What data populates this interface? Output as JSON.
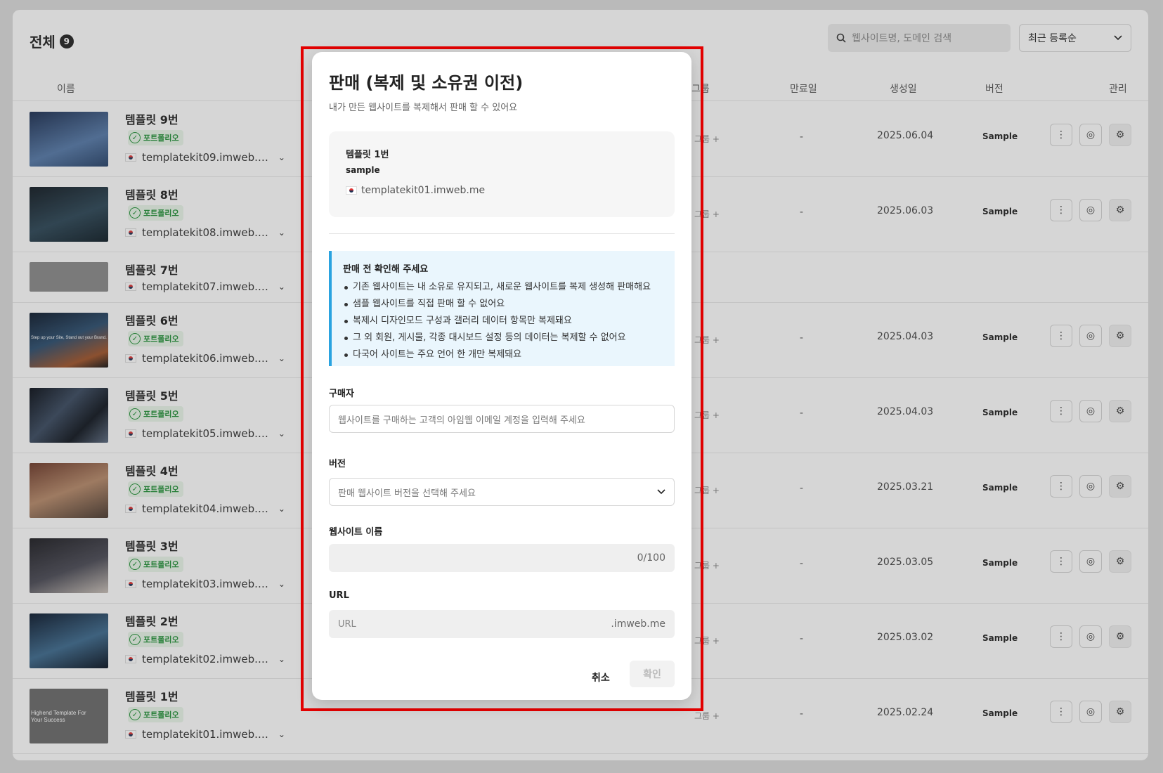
{
  "header": {
    "title": "전체",
    "count": "9"
  },
  "search": {
    "placeholder": "웹사이트명, 도메인 검색"
  },
  "sort": {
    "selected": "최근 등록순"
  },
  "columns": {
    "name": "이름",
    "group": "그룹",
    "expiry": "만료일",
    "created": "생성일",
    "version": "버전",
    "manage": "관리"
  },
  "rows": [
    {
      "name": "템플릿 9번",
      "badge": "포트폴리오",
      "domain": "templatekit09.imweb.…",
      "group": "그룹 +",
      "expiry": "-",
      "created": "2025.06.04",
      "version": "Sample"
    },
    {
      "name": "템플릿 8번",
      "badge": "포트폴리오",
      "domain": "templatekit08.imweb.…",
      "group": "그룹 +",
      "expiry": "-",
      "created": "2025.06.03",
      "version": "Sample"
    },
    {
      "name": "템플릿 7번",
      "badge": "",
      "domain": "templatekit07.imweb.…",
      "group": "",
      "expiry": "",
      "created": "",
      "version": ""
    },
    {
      "name": "템플릿 6번",
      "badge": "포트폴리오",
      "domain": "templatekit06.imweb.…",
      "group": "그룹 +",
      "expiry": "-",
      "created": "2025.04.03",
      "version": "Sample"
    },
    {
      "name": "템플릿 5번",
      "badge": "포트폴리오",
      "domain": "templatekit05.imweb.…",
      "group": "그룹 +",
      "expiry": "-",
      "created": "2025.04.03",
      "version": "Sample"
    },
    {
      "name": "템플릿 4번",
      "badge": "포트폴리오",
      "domain": "templatekit04.imweb.…",
      "group": "그룹 +",
      "expiry": "-",
      "created": "2025.03.21",
      "version": "Sample"
    },
    {
      "name": "템플릿 3번",
      "badge": "포트폴리오",
      "domain": "templatekit03.imweb.…",
      "group": "그룹 +",
      "expiry": "-",
      "created": "2025.03.05",
      "version": "Sample"
    },
    {
      "name": "템플릿 2번",
      "badge": "포트폴리오",
      "domain": "templatekit02.imweb.…",
      "group": "그룹 +",
      "expiry": "-",
      "created": "2025.03.02",
      "version": "Sample"
    },
    {
      "name": "템플릿 1번",
      "badge": "포트폴리오",
      "domain": "templatekit01.imweb.…",
      "group": "그룹 +",
      "expiry": "-",
      "created": "2025.02.24",
      "version": "Sample"
    }
  ],
  "thumb_texts": {
    "row9": "Highend Template For Your Success",
    "row6": "Step up your Site, Stand out your Brand."
  },
  "modal": {
    "title": "판매 (복제 및 소유권 이전)",
    "subtitle": "내가 만든 웹사이트를 복제해서 판매 할 수 있어요",
    "source": {
      "name": "템플릿 1번",
      "version": "sample",
      "domain": "templatekit01.imweb.me"
    },
    "notice": {
      "title": "판매 전 확인해 주세요",
      "items": [
        "기존 웹사이트는 내 소유로 유지되고, 새로운 웹사이트를 복제 생성해 판매해요",
        "샘플 웹사이트를 직접 판매 할 수 없어요",
        "복제시 디자인모드 구성과 갤러리 데이터 항목만 복제돼요",
        "그 외 회원, 게시물, 각종 대시보드 설정 등의 데이터는 복제할 수 없어요",
        "다국어 사이트는 주요 언어 한 개만 복제돼요"
      ]
    },
    "buyer": {
      "label": "구매자",
      "placeholder": "웹사이트를 구매하는 고객의 아임웹 이메일 계정을 입력해 주세요"
    },
    "version": {
      "label": "버전",
      "placeholder": "판매 웹사이트 버전을 선택해 주세요"
    },
    "site_name": {
      "label": "웹사이트 이름",
      "counter": "0/100"
    },
    "url": {
      "label": "URL",
      "placeholder": "URL",
      "suffix": ".imweb.me"
    },
    "cancel_label": "취소",
    "confirm_label": "확인"
  },
  "colors": {
    "highlight": "#e40000",
    "notice_bar": "#2aa3e0",
    "badge_green": "#1e8f34"
  }
}
